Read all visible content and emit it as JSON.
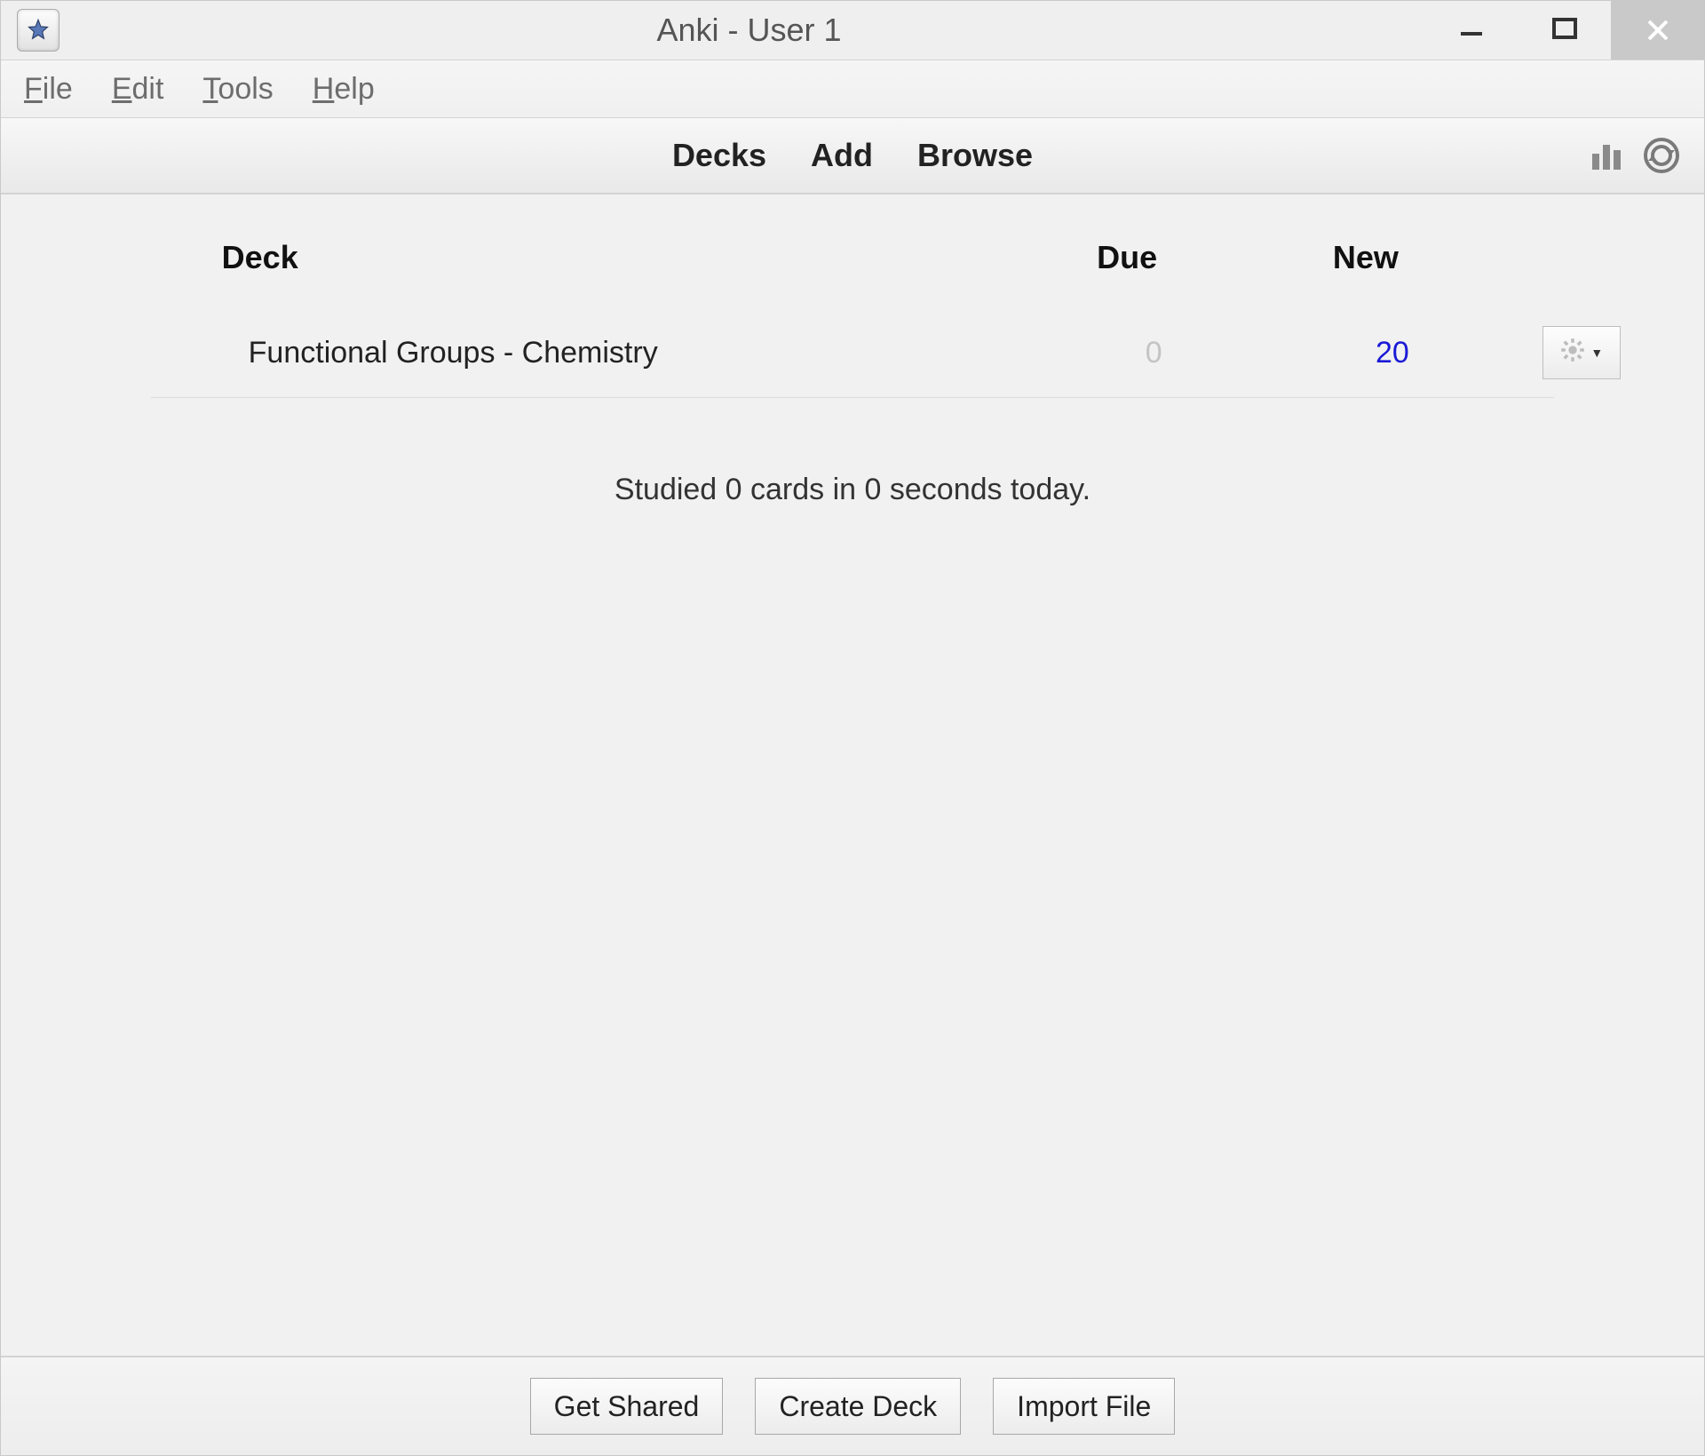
{
  "window": {
    "title": "Anki - User 1"
  },
  "menubar": {
    "file": {
      "label": "File",
      "hotkey": "F"
    },
    "edit": {
      "label": "Edit",
      "hotkey": "E"
    },
    "tools": {
      "label": "Tools",
      "hotkey": "T"
    },
    "help": {
      "label": "Help",
      "hotkey": "H"
    }
  },
  "toolbar": {
    "decks": "Decks",
    "add": "Add",
    "browse": "Browse"
  },
  "columns": {
    "deck": "Deck",
    "due": "Due",
    "new": "New"
  },
  "decks": [
    {
      "name": "Functional Groups - Chemistry",
      "due": "0",
      "new": "20"
    }
  ],
  "status": "Studied 0 cards in 0 seconds today.",
  "bottom": {
    "get_shared": "Get Shared",
    "create_deck": "Create Deck",
    "import_file": "Import File"
  }
}
